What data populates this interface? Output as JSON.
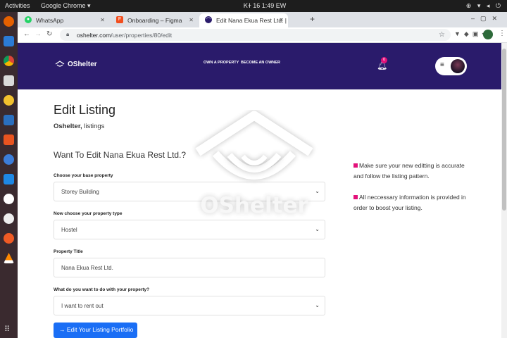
{
  "os_bar": {
    "activities": "Activities",
    "app_name": "Google Chrome ▾",
    "clock": "ᏦᏐ 16   1:49 EW"
  },
  "browser": {
    "tabs": [
      {
        "label": "WhatsApp",
        "icon": "whatsapp-icon",
        "color": "#25d366"
      },
      {
        "label": "Onboarding – Figma",
        "icon": "figma-icon",
        "color": "#f24e1e"
      },
      {
        "label": "Edit Nana Ekua Rest Ltd. |",
        "icon": "oshelter-icon",
        "color": "#2a1b6b"
      }
    ],
    "url_host": "oshelter.com",
    "url_path": "/user/properties/80/edit"
  },
  "site": {
    "brand": "OShelter",
    "nav": [
      "OWN A PROPERTY",
      "BECOME AN OWNER"
    ],
    "notification_count": "0",
    "colors": {
      "header": "#2a1b6b",
      "accent": "#e3117a",
      "button": "#1a6ef5"
    }
  },
  "page": {
    "title": "Edit Listing",
    "crumb_bold": "Oshelter,",
    "crumb_rest": " listings",
    "heading": "Want To Edit Nana Ekua Rest Ltd.?",
    "fields": [
      {
        "label": "Choose your base property",
        "value": "Storey Building",
        "type": "select"
      },
      {
        "label": "Now choose your property type",
        "value": "Hostel",
        "type": "select"
      },
      {
        "label": "Property Title",
        "value": "Nana Ekua Rest Ltd.",
        "type": "text"
      },
      {
        "label": "What do you want to do with your property?",
        "value": "I want to rent out",
        "type": "select"
      }
    ],
    "submit_label": "→ Edit Your Listing Portfolio",
    "notes": [
      "Make sure your new editting is accurate and follow the listing pattern.",
      "All neccessary information is provided in order to boost your listing."
    ],
    "watermark_text": "OShelter"
  }
}
